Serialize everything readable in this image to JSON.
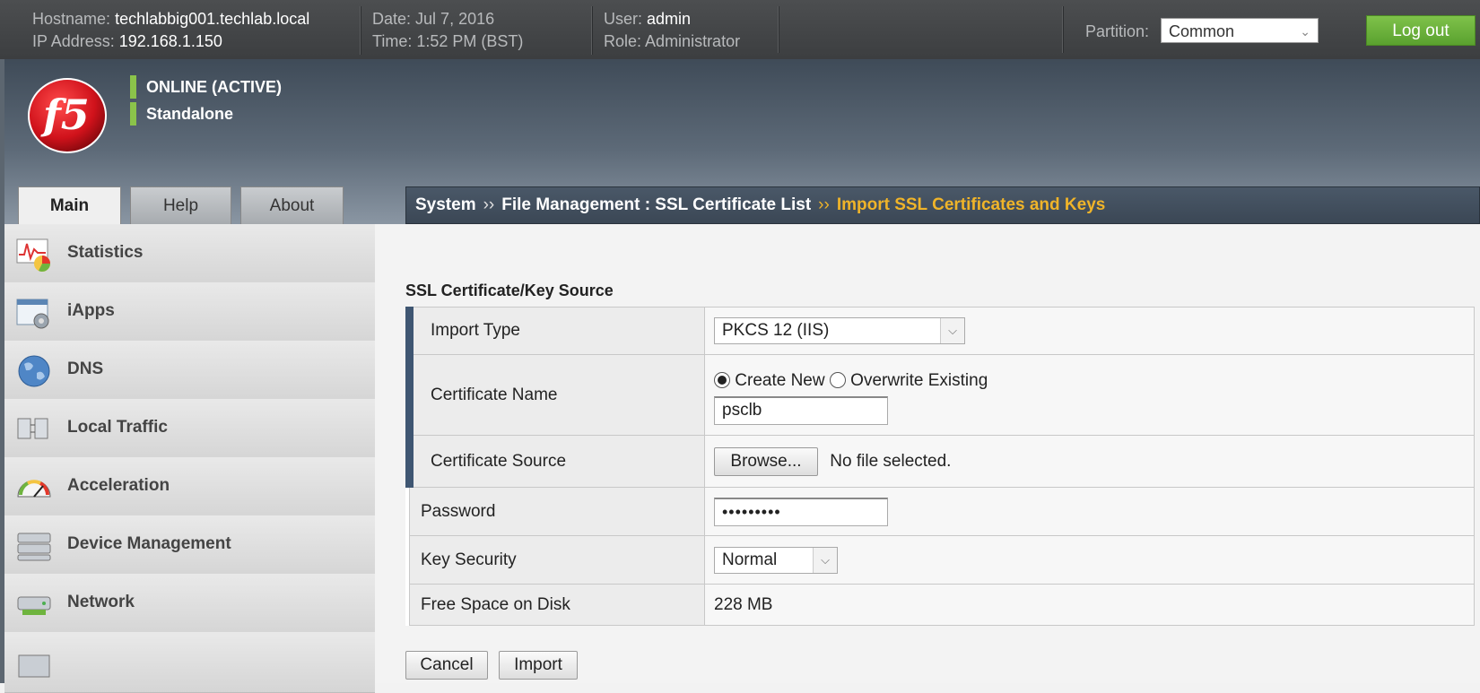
{
  "topbar": {
    "hostname_label": "Hostname:",
    "hostname": "techlabbig001.techlab.local",
    "ip_label": "IP Address:",
    "ip": "192.168.1.150",
    "date_label": "Date:",
    "date": "Jul 7, 2016",
    "time_label": "Time:",
    "time": "1:52 PM (BST)",
    "user_label": "User:",
    "user": "admin",
    "role_label": "Role:",
    "role": "Administrator",
    "partition_label": "Partition:",
    "partition_value": "Common",
    "logout_label": "Log out"
  },
  "status": {
    "state": "ONLINE (ACTIVE)",
    "mode": "Standalone",
    "indicator_color": "#8bc34a"
  },
  "tabs": [
    {
      "label": "Main",
      "active": true
    },
    {
      "label": "Help",
      "active": false
    },
    {
      "label": "About",
      "active": false
    }
  ],
  "breadcrumb": {
    "root": "System",
    "separator": "››",
    "parent": "File Management : SSL Certificate List",
    "current": "Import SSL Certificates and Keys",
    "current_color": "#f0b429"
  },
  "sidebar": {
    "items": [
      {
        "label": "Statistics",
        "icon": "statistics-icon"
      },
      {
        "label": "iApps",
        "icon": "iapps-icon"
      },
      {
        "label": "DNS",
        "icon": "globe-icon"
      },
      {
        "label": "Local Traffic",
        "icon": "local-traffic-icon"
      },
      {
        "label": "Acceleration",
        "icon": "gauge-icon"
      },
      {
        "label": "Device Management",
        "icon": "server-icon"
      },
      {
        "label": "Network",
        "icon": "network-icon"
      }
    ]
  },
  "form": {
    "section_title": "SSL Certificate/Key Source",
    "import_type": {
      "label": "Import Type",
      "value": "PKCS 12 (IIS)"
    },
    "certificate_name": {
      "label": "Certificate Name",
      "option_new": "Create New",
      "option_overwrite": "Overwrite Existing",
      "selected": "Create New",
      "value": "psclb"
    },
    "certificate_source": {
      "label": "Certificate Source",
      "browse_label": "Browse...",
      "file_status": "No file selected."
    },
    "password": {
      "label": "Password",
      "value": "•••••••••"
    },
    "key_security": {
      "label": "Key Security",
      "value": "Normal"
    },
    "free_space": {
      "label": "Free Space on Disk",
      "value": "228 MB"
    }
  },
  "buttons": {
    "cancel": "Cancel",
    "import": "Import"
  }
}
